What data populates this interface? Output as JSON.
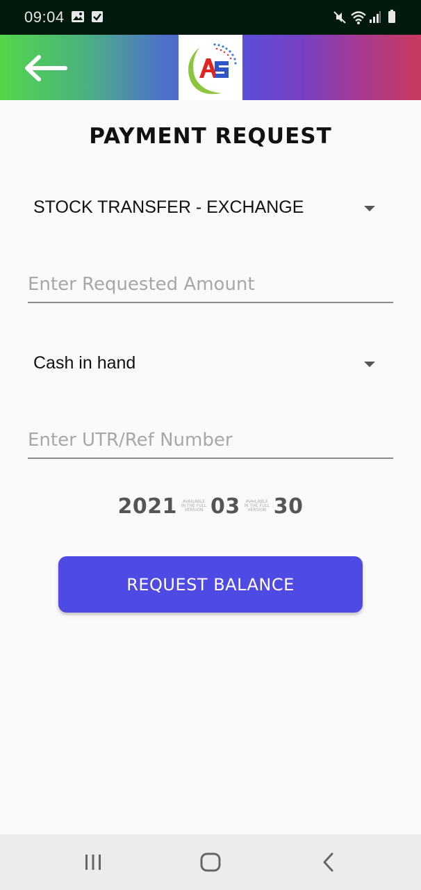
{
  "status_bar": {
    "time": "09:04",
    "icons": [
      "gallery-icon",
      "check-square-icon",
      "mute-icon",
      "wifi-icon",
      "signal-icon",
      "battery-icon"
    ]
  },
  "app_bar": {
    "back_icon": "arrow-left-icon",
    "logo_icon": "aes-logo"
  },
  "page": {
    "title": "PAYMENT REQUEST"
  },
  "form": {
    "transfer_type": {
      "value": "STOCK TRANSFER - EXCHANGE"
    },
    "amount": {
      "value": "",
      "placeholder": "Enter Requested Amount"
    },
    "payment_mode": {
      "value": "Cash in hand"
    },
    "utr": {
      "value": "",
      "placeholder": "Enter UTR/Ref Number"
    },
    "date": {
      "year": "2021",
      "month": "03",
      "day": "30",
      "separator_text": "AVAILABLE IN THE FULL VERSION"
    },
    "submit_label": "REQUEST BALANCE"
  },
  "nav_bar": {
    "icons": [
      "recents-icon",
      "home-icon",
      "back-icon"
    ]
  },
  "colors": {
    "status_bar": "#02190e",
    "accent": "#4f4ae3",
    "background": "#fafafa",
    "nav_bar": "#ececec"
  }
}
